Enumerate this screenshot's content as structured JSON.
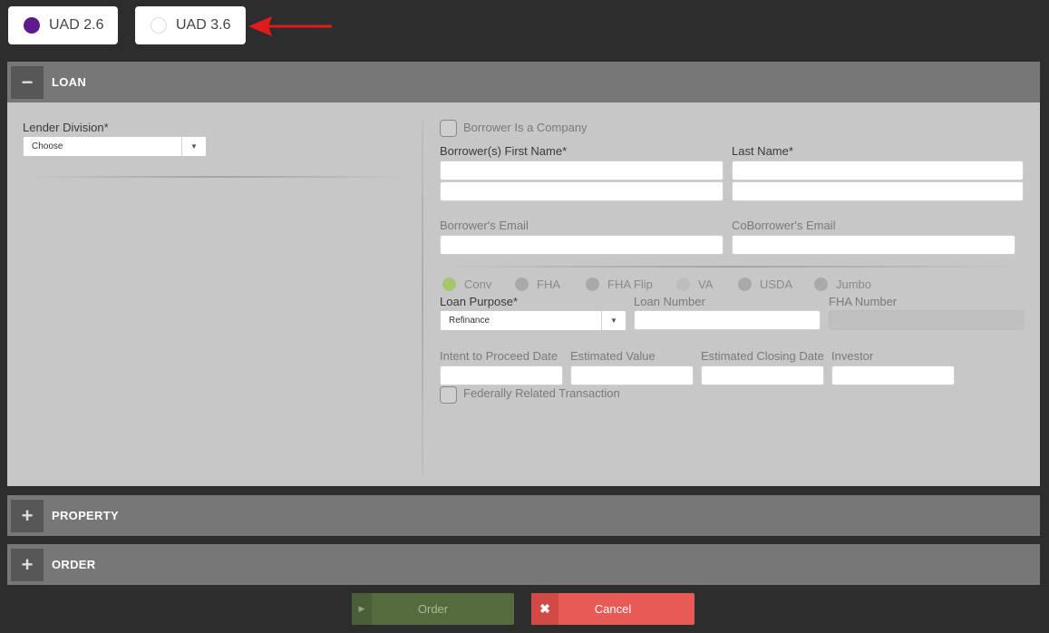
{
  "uad_options": [
    {
      "label": "UAD 2.6",
      "selected": true
    },
    {
      "label": "UAD 3.6",
      "selected": false
    }
  ],
  "sections": {
    "loan": {
      "title": "LOAN",
      "toggle": "−"
    },
    "property": {
      "title": "PROPERTY",
      "toggle": "+"
    },
    "order": {
      "title": "ORDER",
      "toggle": "+"
    }
  },
  "loan": {
    "lender_division": {
      "label": "Lender Division*",
      "value": "Choose"
    },
    "borrower_is_company": {
      "label": "Borrower Is a Company",
      "checked": false
    },
    "borrower_first_name": {
      "label": "Borrower(s) First Name*",
      "value": "",
      "value2": ""
    },
    "last_name": {
      "label": "Last Name*",
      "value": "",
      "value2": ""
    },
    "borrower_email": {
      "label": "Borrower's Email",
      "value": ""
    },
    "coborrower_email": {
      "label": "CoBorrower's Email",
      "value": ""
    },
    "loan_types": [
      {
        "label": "Conv",
        "selected": true
      },
      {
        "label": "FHA",
        "selected": false
      },
      {
        "label": "FHA Flip",
        "selected": false
      },
      {
        "label": "VA",
        "selected": false
      },
      {
        "label": "USDA",
        "selected": false
      },
      {
        "label": "Jumbo",
        "selected": false
      }
    ],
    "loan_purpose": {
      "label": "Loan Purpose*",
      "value": "Refinance"
    },
    "loan_number": {
      "label": "Loan Number",
      "value": ""
    },
    "fha_number": {
      "label": "FHA Number",
      "value": ""
    },
    "intent_to_proceed_date": {
      "label": "Intent to Proceed Date",
      "value": ""
    },
    "estimated_value": {
      "label": "Estimated Value",
      "value": ""
    },
    "estimated_closing_date": {
      "label": "Estimated Closing Date",
      "value": ""
    },
    "investor": {
      "label": "Investor",
      "value": ""
    },
    "federally_related": {
      "label": "Federally Related Transaction",
      "checked": false
    }
  },
  "buttons": {
    "order": {
      "label": "Order",
      "icon": "play-icon"
    },
    "cancel": {
      "label": "Cancel",
      "icon": "close-icon"
    }
  },
  "colors": {
    "accent_selected": "#5e1a8c",
    "loan_type_selected": "#a6c66a",
    "order_button": "#546b3e",
    "cancel_button": "#e85a55",
    "annotation_arrow": "#e01b1b"
  }
}
